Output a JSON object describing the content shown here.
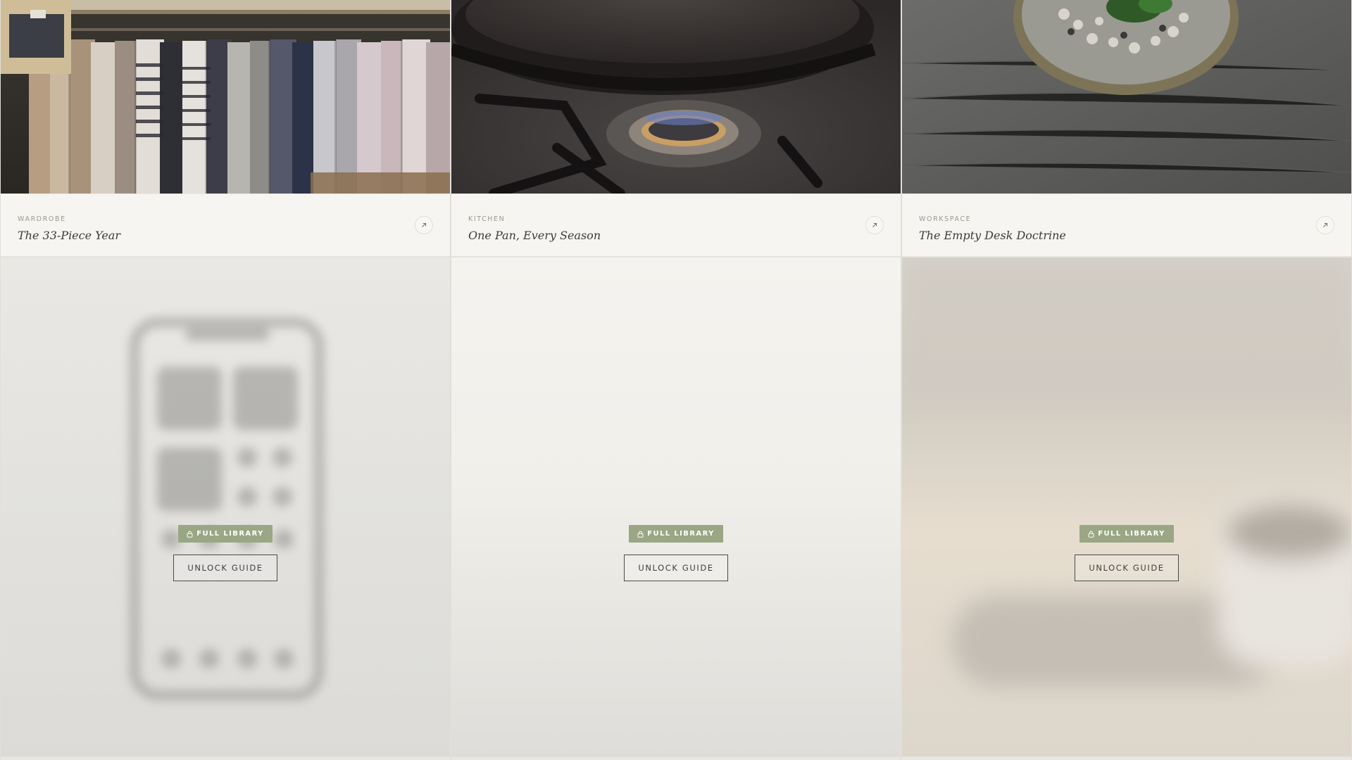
{
  "guides_top": [
    {
      "category": "WARDROBE",
      "title": "The 33-Piece Year",
      "open_icon": "arrow-up-right-icon",
      "photo": "clothing-rack-photo"
    },
    {
      "category": "KITCHEN",
      "title": "One Pan, Every Season",
      "open_icon": "arrow-up-right-icon",
      "photo": "cast-iron-pan-photo"
    },
    {
      "category": "WORKSPACE",
      "title": "The Empty Desk Doctrine",
      "open_icon": "arrow-up-right-icon",
      "photo": "terrarium-desk-photo"
    }
  ],
  "guides_locked": [
    {
      "badge": "FULL LIBRARY",
      "badge_icon": "lock-icon",
      "button": "UNLOCK GUIDE",
      "preview": "blurred-phone-preview"
    },
    {
      "badge": "FULL LIBRARY",
      "badge_icon": "lock-icon",
      "button": "UNLOCK GUIDE",
      "preview": "blurred-blank-preview"
    },
    {
      "badge": "FULL LIBRARY",
      "badge_icon": "lock-icon",
      "button": "UNLOCK GUIDE",
      "preview": "blurred-desk-mug-preview"
    }
  ],
  "colors": {
    "badge_bg": "#9aa684",
    "caption_bg": "#f6f5f1",
    "title_text": "#3c3b37"
  }
}
